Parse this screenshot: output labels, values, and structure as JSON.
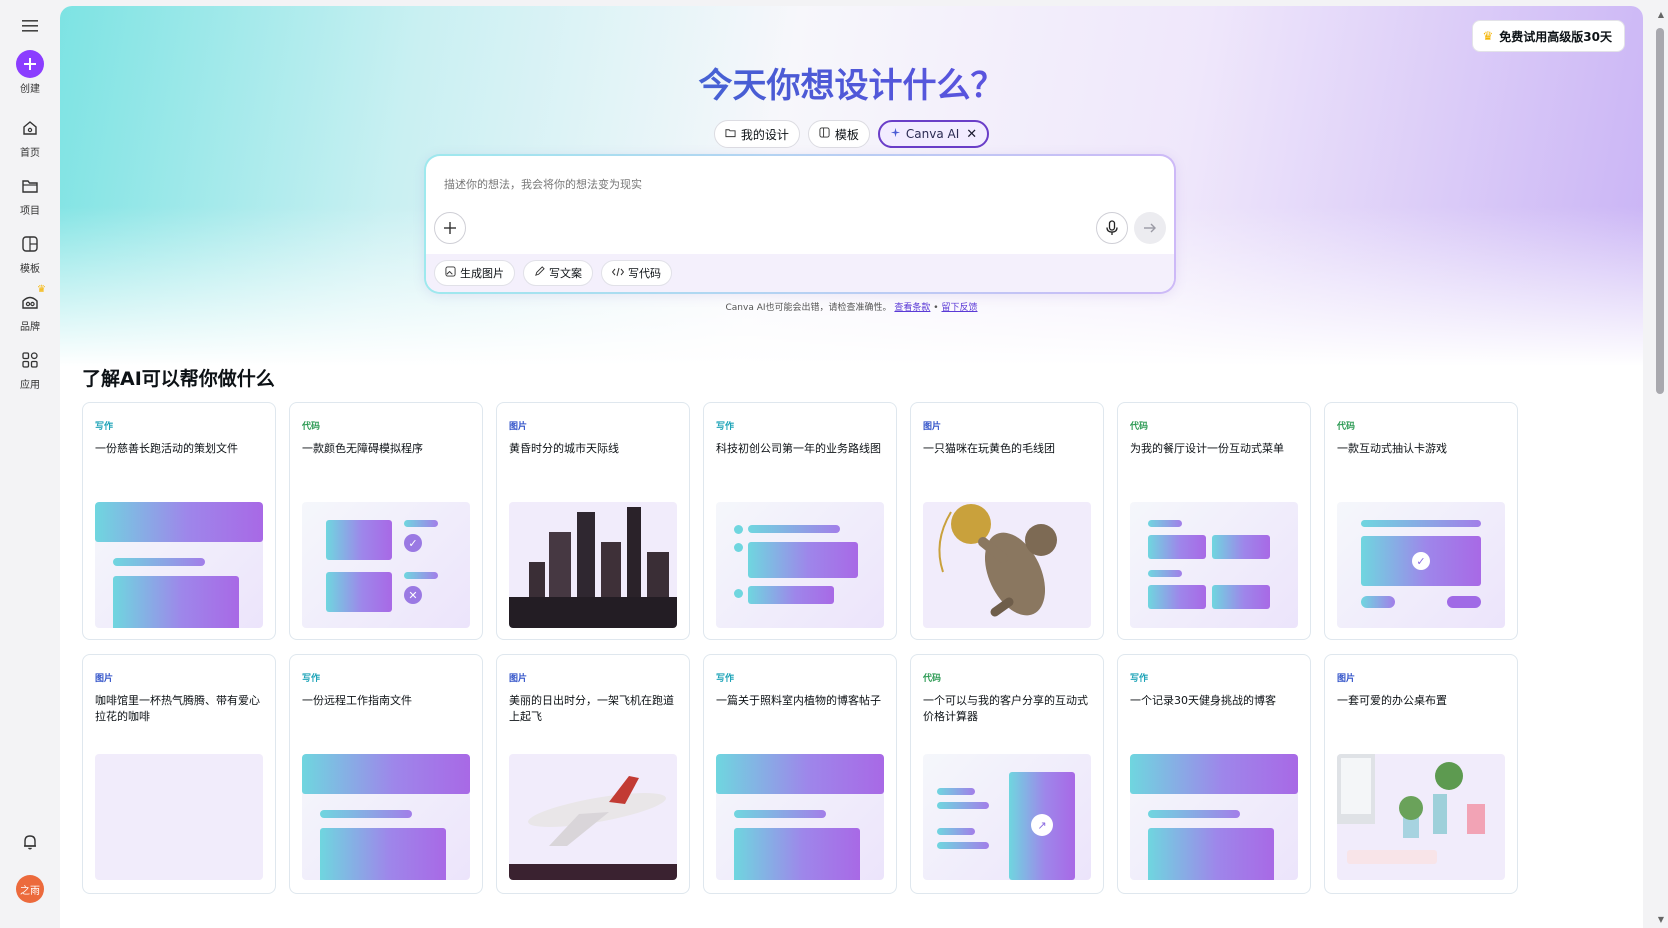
{
  "rail": {
    "items": [
      {
        "label": "创建"
      },
      {
        "label": "首页"
      },
      {
        "label": "项目"
      },
      {
        "label": "模板"
      },
      {
        "label": "品牌"
      },
      {
        "label": "应用"
      }
    ],
    "avatar_text": "之雨"
  },
  "header": {
    "trial_button": "免费试用高级版30天",
    "title": "今天你想设计什么？"
  },
  "tabs": [
    {
      "label": "我的设计"
    },
    {
      "label": "模板"
    },
    {
      "label": "Canva AI"
    }
  ],
  "prompt": {
    "placeholder": "描述你的想法，我会将你的想法变为现实",
    "chips": [
      {
        "label": "生成图片"
      },
      {
        "label": "写文案"
      },
      {
        "label": "写代码"
      }
    ]
  },
  "disclaimer": {
    "text": "Canva AI也可能会出错，请检查准确性。",
    "terms_link": "查看条款",
    "separator": "•",
    "feedback_link": "留下反馈"
  },
  "section": {
    "title": "了解AI可以帮你做什么"
  },
  "cards": [
    {
      "tag": "写作",
      "desc": "一份慈善长跑活动的策划文件"
    },
    {
      "tag": "代码",
      "desc": "一款颜色无障碍模拟程序"
    },
    {
      "tag": "图片",
      "desc": "黄昏时分的城市天际线"
    },
    {
      "tag": "写作",
      "desc": "科技初创公司第一年的业务路线图"
    },
    {
      "tag": "图片",
      "desc": "一只猫咪在玩黄色的毛线团"
    },
    {
      "tag": "代码",
      "desc": "为我的餐厅设计一份互动式菜单"
    },
    {
      "tag": "代码",
      "desc": "一款互动式抽认卡游戏"
    },
    {
      "tag": "图片",
      "desc": "咖啡馆里一杯热气腾腾、带有爱心拉花的咖啡"
    },
    {
      "tag": "写作",
      "desc": "一份远程工作指南文件"
    },
    {
      "tag": "图片",
      "desc": "美丽的日出时分，一架飞机在跑道上起飞"
    },
    {
      "tag": "写作",
      "desc": "一篇关于照料室内植物的博客帖子"
    },
    {
      "tag": "代码",
      "desc": "一个可以与我的客户分享的互动式价格计算器"
    },
    {
      "tag": "写作",
      "desc": "一个记录30天健身挑战的博客"
    },
    {
      "tag": "图片",
      "desc": "一套可爱的办公桌布置"
    }
  ]
}
